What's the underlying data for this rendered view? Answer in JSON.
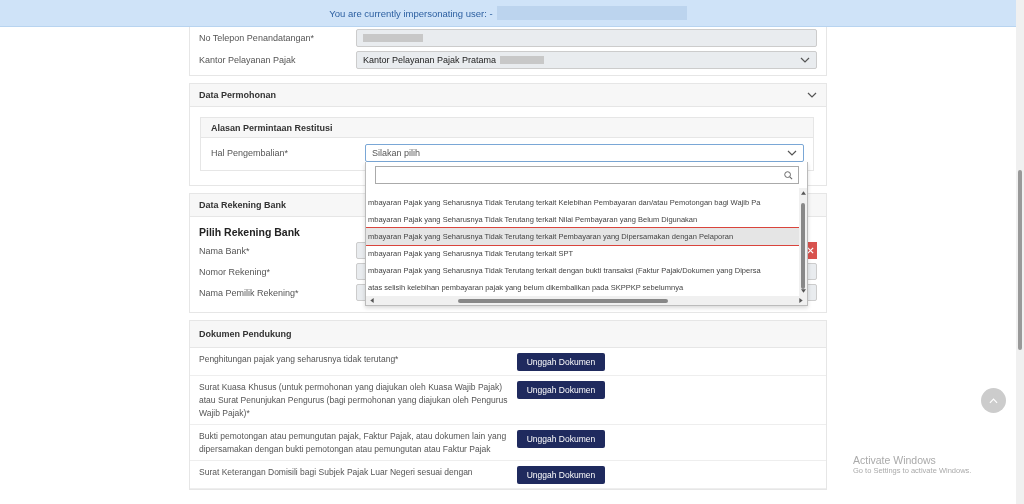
{
  "banner": {
    "text": "You are currently impersonating user: -"
  },
  "signer_card": {
    "fields": [
      {
        "label": "No Telepon Penandatangan*",
        "kind": "text"
      },
      {
        "label": "Kantor Pelayanan Pajak",
        "kind": "select",
        "value": "Kantor Pelayanan Pajak Pratama"
      }
    ]
  },
  "permohonan": {
    "title": "Data Permohonan",
    "expanded": true,
    "subsection": "Alasan Permintaan Restitusi",
    "field_label": "Hal Pengembalian*",
    "select": {
      "placeholder": "Silakan pilih",
      "expanded": true
    },
    "options": [
      {
        "text": "mbayaran Pajak yang Seharusnya Tidak Terutang terkait Kelebihan Pembayaran dan/atau Pemotongan bagi Wajib Pa",
        "selected": false
      },
      {
        "text": "mbayaran Pajak yang Seharusnya Tidak Terutang terkait Nilai Pembayaran yang Belum Digunakan",
        "selected": false
      },
      {
        "text": "mbayaran Pajak yang Seharusnya Tidak Terutang terkait Pembayaran yang Dipersamakan dengan Pelaporan",
        "selected": true
      },
      {
        "text": "mbayaran Pajak yang Seharusnya Tidak Terutang terkait SPT",
        "selected": false
      },
      {
        "text": "mbayaran Pajak yang Seharusnya Tidak Terutang terkait dengan bukti transaksi (Faktur Pajak/Dokumen yang Dipersa",
        "selected": false
      },
      {
        "text": "atas selisih kelebihan pembayaran pajak yang belum dikembalikan pada SKPPKP sebelumnya",
        "selected": false
      }
    ]
  },
  "bank": {
    "title": "Data Rekening Bank",
    "heading": "Pilih Rekening Bank",
    "fields": [
      {
        "label": "Nama Bank*",
        "kind": "removable"
      },
      {
        "label": "Nomor Rekening*",
        "kind": "text"
      },
      {
        "label": "Nama Pemilik Rekening*",
        "kind": "text"
      }
    ]
  },
  "documents": {
    "title": "Dokumen Pendukung",
    "rows": [
      {
        "text": "Penghitungan pajak yang seharusnya tidak terutang*",
        "button": "Unggah Dokumen"
      },
      {
        "text": "Surat Kuasa Khusus (untuk permohonan yang diajukan oleh Kuasa Wajib Pajak) atau Surat Penunjukan Pengurus (bagi permohonan yang diajukan oleh Pengurus Wajib Pajak)*",
        "button": "Unggah Dokumen"
      },
      {
        "text": "Bukti pemotongan atau pemungutan pajak, Faktur Pajak, atau dokumen lain yang dipersamakan dengan bukti pemotongan atau pemungutan atau Faktur Pajak",
        "button": "Unggah Dokumen"
      },
      {
        "text": "Surat Keterangan Domisili bagi Subjek Pajak Luar Negeri sesuai dengan",
        "button": "Unggah Dokumen"
      }
    ]
  },
  "windows_notice": {
    "title": "Activate Windows",
    "subtitle": "Go to Settings to activate Windows."
  }
}
